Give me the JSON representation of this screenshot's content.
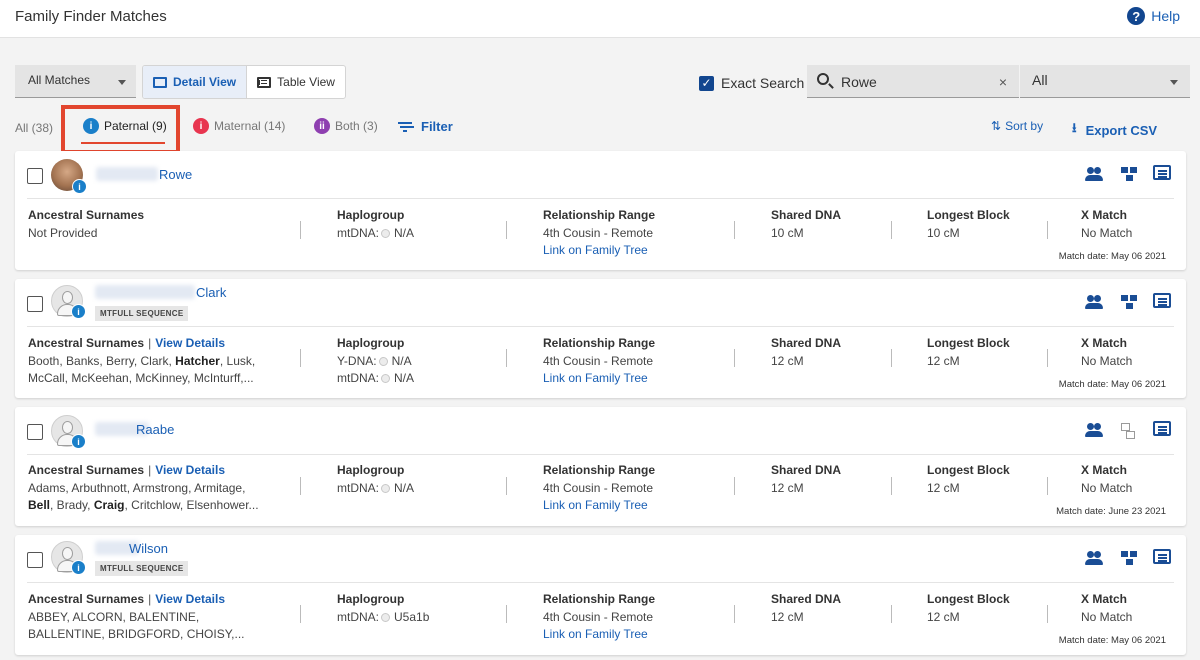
{
  "header": {
    "title": "Family Finder Matches",
    "help_label": "Help"
  },
  "controls": {
    "matches_dropdown": "All Matches",
    "detail_view": "Detail View",
    "table_view": "Table View",
    "exact_search": "Exact Search",
    "search_value": "Rowe",
    "clear": "×",
    "right_dropdown": "All"
  },
  "tabs": {
    "all": "All (38)",
    "paternal": "Paternal (9)",
    "maternal": "Maternal (14)",
    "both": "Both (3)",
    "filter": "Filter",
    "sort_by": "Sort by",
    "export": "Export CSV"
  },
  "columns": {
    "surnames": "Ancestral Surnames",
    "view_details": "View Details",
    "haplogroup": "Haplogroup",
    "relationship": "Relationship Range",
    "shared_dna": "Shared DNA",
    "longest_block": "Longest Block",
    "x_match": "X Match",
    "link_tree": "Link on Family Tree"
  },
  "colors": {
    "accent": "#1a5fb4",
    "highlight": "#e2462e",
    "paternal": "#1a7fc9",
    "maternal": "#e8354f",
    "both": "#8e3fb0"
  },
  "matches": [
    {
      "name": "Rowe",
      "surnames_line1": "Not Provided",
      "haplo_line1_label": "mtDNA:",
      "haplo_line1_value": "N/A",
      "relationship": "4th Cousin - Remote",
      "shared": "10 cM",
      "block": "10 cM",
      "xmatch": "No Match",
      "date": "Match date: May 06 2021"
    },
    {
      "name": "Clark",
      "tag": "MTFULL SEQUENCE",
      "surnames_line1_a": "Booth, Banks, Berry, Clark, ",
      "surnames_line1_b": "Hatcher",
      "surnames_line1_c": ", Lusk,",
      "surnames_line2": "McCall, McKeehan, McKinney, McInturff,...",
      "haplo_line1_label": "Y-DNA:",
      "haplo_line1_value": "N/A",
      "haplo_line2_label": "mtDNA:",
      "haplo_line2_value": "N/A",
      "relationship": "4th Cousin - Remote",
      "shared": "12 cM",
      "block": "12 cM",
      "xmatch": "No Match",
      "date": "Match date: May 06 2021"
    },
    {
      "name": "Raabe",
      "surnames_line1": "Adams, Arbuthnott, Armstrong, Armitage,",
      "surnames_line2_a": "Bell",
      "surnames_line2_b": ", Brady, ",
      "surnames_line2_c": "Craig",
      "surnames_line2_d": ", Critchlow, Elsenhower...",
      "haplo_line1_label": "mtDNA:",
      "haplo_line1_value": "N/A",
      "relationship": "4th Cousin - Remote",
      "shared": "12 cM",
      "block": "12 cM",
      "xmatch": "No Match",
      "date": "Match date: June 23 2021"
    },
    {
      "name": "Wilson",
      "tag": "MTFULL SEQUENCE",
      "surnames_line1": "ABBEY, ALCORN, BALENTINE,",
      "surnames_line2": "BALLENTINE, BRIDGFORD, CHOISY,...",
      "haplo_line1_label": "mtDNA:",
      "haplo_line1_value": "U5a1b",
      "relationship": "4th Cousin - Remote",
      "shared": "12 cM",
      "block": "12 cM",
      "xmatch": "No Match",
      "date": "Match date: May 06 2021"
    }
  ]
}
